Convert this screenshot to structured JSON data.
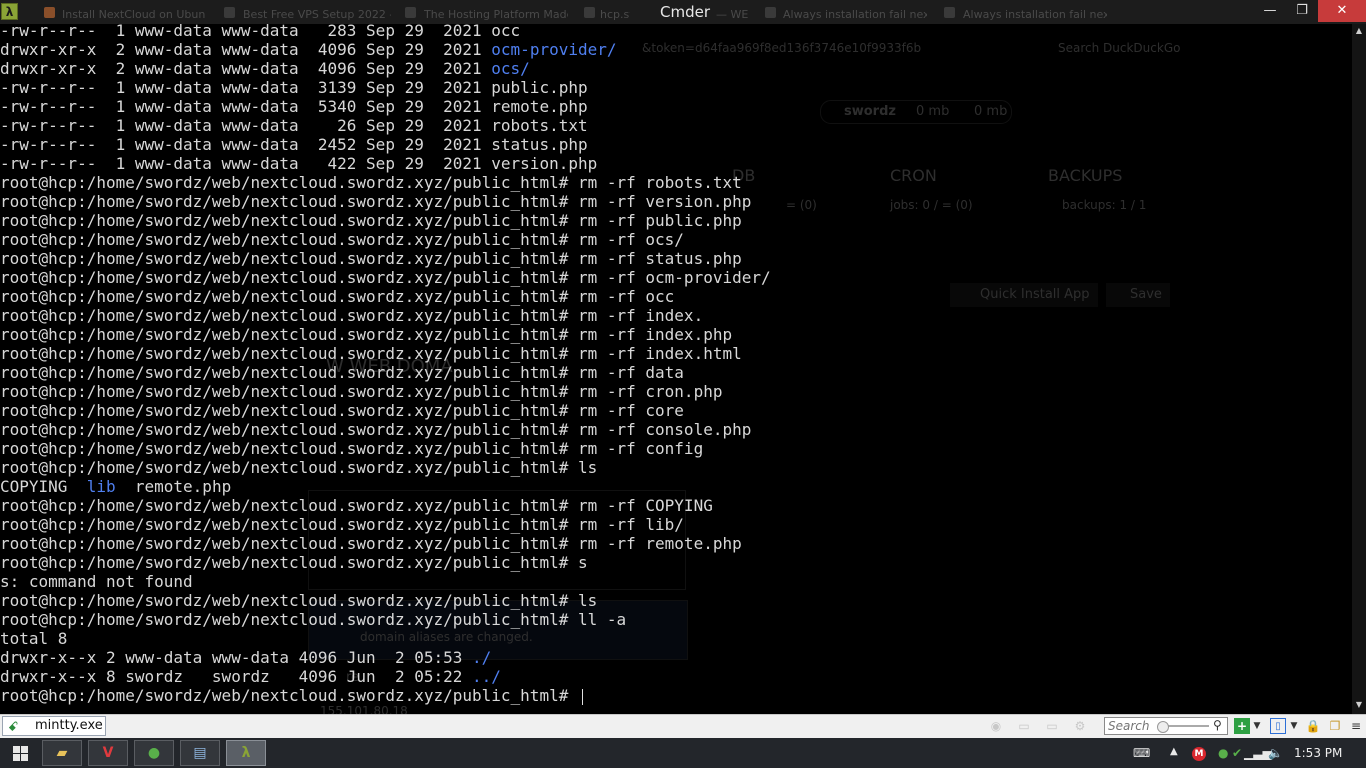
{
  "window": {
    "app_icon": "λ",
    "title": "Cmder",
    "minimize": "—",
    "maximize": "❐",
    "close": "✕"
  },
  "background_tabs": [
    "Install NextCloud on Ubun",
    "Best Free VPS Setup 2022 -",
    "The Hosting Platform Made",
    "hcp.swordz",
    "— WE",
    "Always installation fail nex",
    "Always installation fail nex"
  ],
  "ghost_ui": {
    "url_token": "&token=d64faa969f8ed136f3746e10f9933f6b",
    "search_placeholder": "Search DuckDuckGo",
    "user": "swordz",
    "mem1": "0 mb",
    "mem2": "0 mb",
    "db_heading": "DB",
    "db_value": "= (0)",
    "cron_heading": "CRON",
    "cron_value": "jobs: 0 / = (0)",
    "backups_heading": "BACKUPS",
    "backups_value": "backups: 1 / 1",
    "quick_install": "Quick Install App",
    "save": "Save",
    "web_domain_fragment": "W WEB DOMA",
    "notice_fragment": "domain aliases are changed.",
    "ip_fragment": "155.101.80.18",
    "rec_fragment": "re"
  },
  "terminal": {
    "lines": [
      {
        "t": "-rw-r--r--  1 www-data www-data   283 Sep 29  2021 occ"
      },
      {
        "t": "drwxr-xr-x  2 www-data www-data  4096 Sep 29  2021 ",
        "dir": "ocm-provider/"
      },
      {
        "t": "drwxr-xr-x  2 www-data www-data  4096 Sep 29  2021 ",
        "dir": "ocs/"
      },
      {
        "t": "-rw-r--r--  1 www-data www-data  3139 Sep 29  2021 public.php"
      },
      {
        "t": "-rw-r--r--  1 www-data www-data  5340 Sep 29  2021 remote.php"
      },
      {
        "t": "-rw-r--r--  1 www-data www-data    26 Sep 29  2021 robots.txt"
      },
      {
        "t": "-rw-r--r--  1 www-data www-data  2452 Sep 29  2021 status.php"
      },
      {
        "t": "-rw-r--r--  1 www-data www-data   422 Sep 29  2021 version.php"
      },
      {
        "t": "root@hcp:/home/swordz/web/nextcloud.swordz.xyz/public_html# rm -rf robots.txt"
      },
      {
        "t": "root@hcp:/home/swordz/web/nextcloud.swordz.xyz/public_html# rm -rf version.php"
      },
      {
        "t": "root@hcp:/home/swordz/web/nextcloud.swordz.xyz/public_html# rm -rf public.php"
      },
      {
        "t": "root@hcp:/home/swordz/web/nextcloud.swordz.xyz/public_html# rm -rf ocs/"
      },
      {
        "t": "root@hcp:/home/swordz/web/nextcloud.swordz.xyz/public_html# rm -rf status.php"
      },
      {
        "t": "root@hcp:/home/swordz/web/nextcloud.swordz.xyz/public_html# rm -rf ocm-provider/"
      },
      {
        "t": "root@hcp:/home/swordz/web/nextcloud.swordz.xyz/public_html# rm -rf occ"
      },
      {
        "t": "root@hcp:/home/swordz/web/nextcloud.swordz.xyz/public_html# rm -rf index."
      },
      {
        "t": "root@hcp:/home/swordz/web/nextcloud.swordz.xyz/public_html# rm -rf index.php"
      },
      {
        "t": "root@hcp:/home/swordz/web/nextcloud.swordz.xyz/public_html# rm -rf index.html"
      },
      {
        "t": "root@hcp:/home/swordz/web/nextcloud.swordz.xyz/public_html# rm -rf data"
      },
      {
        "t": "root@hcp:/home/swordz/web/nextcloud.swordz.xyz/public_html# rm -rf cron.php"
      },
      {
        "t": "root@hcp:/home/swordz/web/nextcloud.swordz.xyz/public_html# rm -rf core"
      },
      {
        "t": "root@hcp:/home/swordz/web/nextcloud.swordz.xyz/public_html# rm -rf console.php"
      },
      {
        "t": "root@hcp:/home/swordz/web/nextcloud.swordz.xyz/public_html# rm -rf config"
      },
      {
        "t": "root@hcp:/home/swordz/web/nextcloud.swordz.xyz/public_html# ls"
      },
      {
        "t": "COPYING  ",
        "dir": "lib",
        "t2": "  remote.php"
      },
      {
        "t": "root@hcp:/home/swordz/web/nextcloud.swordz.xyz/public_html# rm -rf COPYING"
      },
      {
        "t": "root@hcp:/home/swordz/web/nextcloud.swordz.xyz/public_html# rm -rf lib/"
      },
      {
        "t": "root@hcp:/home/swordz/web/nextcloud.swordz.xyz/public_html# rm -rf remote.php"
      },
      {
        "t": "root@hcp:/home/swordz/web/nextcloud.swordz.xyz/public_html# s"
      },
      {
        "t": "s: command not found"
      },
      {
        "t": "root@hcp:/home/swordz/web/nextcloud.swordz.xyz/public_html# ls"
      },
      {
        "t": "root@hcp:/home/swordz/web/nextcloud.swordz.xyz/public_html# ll -a"
      },
      {
        "t": "total 8"
      },
      {
        "t": "drwxr-x--x 2 www-data www-data 4096 Jun  2 05:53 ",
        "dir": "./"
      },
      {
        "t": "drwxr-x--x 8 swordz   swordz   4096 Jun  2 05:22 ",
        "dir": "../"
      },
      {
        "t": "root@hcp:/home/swordz/web/nextcloud.swordz.xyz/public_html# ",
        "cursor": true
      }
    ]
  },
  "statusbar": {
    "tab_label": "mintty.exe",
    "search_placeholder": "Search",
    "add_label": "+",
    "lock_label": "🔒",
    "menu_label": "≡"
  },
  "taskbar": {
    "clock": "1:53 PM",
    "colors": {
      "vivaldi": "#e03a3e",
      "green": "#59b04a",
      "cmder": "#8aa436"
    }
  }
}
